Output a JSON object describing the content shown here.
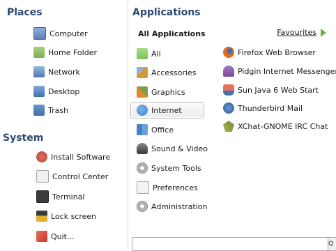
{
  "places": {
    "heading": "Places",
    "items": [
      {
        "label": "Computer",
        "icon": "computer-icon",
        "color": "#5a7fb0"
      },
      {
        "label": "Home Folder",
        "icon": "home-folder-icon",
        "color": "#7dae56"
      },
      {
        "label": "Network",
        "icon": "network-icon",
        "color": "#4d78b3"
      },
      {
        "label": "Desktop",
        "icon": "desktop-icon",
        "color": "#3f6fb0"
      },
      {
        "label": "Trash",
        "icon": "trash-icon",
        "color": "#3e6fa8"
      }
    ]
  },
  "system": {
    "heading": "System",
    "items": [
      {
        "label": "Install Software",
        "icon": "install-software-icon",
        "color": "#b0463a"
      },
      {
        "label": "Control Center",
        "icon": "control-center-icon",
        "color": "#c9c9c9"
      },
      {
        "label": "Terminal",
        "icon": "terminal-icon",
        "color": "#3c3c3c"
      },
      {
        "label": "Lock screen",
        "icon": "lock-screen-icon",
        "color": "#e0b12b"
      },
      {
        "label": "Quit...",
        "icon": "quit-icon",
        "color": "#c43a2a"
      }
    ]
  },
  "applications": {
    "heading": "Applications",
    "all_apps_label": "All Applications",
    "favourites_label": "Favourites",
    "categories": [
      {
        "label": "All",
        "icon": "all-icon",
        "color": "#7dc25a"
      },
      {
        "label": "Accessories",
        "icon": "accessories-icon",
        "color": "#d49a3a"
      },
      {
        "label": "Graphics",
        "icon": "graphics-icon",
        "color": "#e08a2a"
      },
      {
        "label": "Internet",
        "icon": "internet-icon",
        "color": "#3f7fc8"
      },
      {
        "label": "Office",
        "icon": "office-icon",
        "color": "#4a7fc0"
      },
      {
        "label": "Sound & Video",
        "icon": "sound-video-icon",
        "color": "#5a5a5a"
      },
      {
        "label": "System Tools",
        "icon": "system-tools-icon",
        "color": "#a0a0a0"
      },
      {
        "label": "Preferences",
        "icon": "preferences-icon",
        "color": "#bdbdbd"
      },
      {
        "label": "Administration",
        "icon": "administration-icon",
        "color": "#a0a0a0"
      }
    ],
    "selected_category": "Internet",
    "apps": [
      {
        "label": "Firefox Web Browser",
        "icon": "firefox-icon",
        "color": "#e36a1e"
      },
      {
        "label": "Pidgin Internet Messenger",
        "icon": "pidgin-icon",
        "color": "#7a4b9c"
      },
      {
        "label": "Sun Java 6 Web Start",
        "icon": "java-icon",
        "color": "#d0402a"
      },
      {
        "label": "Thunderbird Mail",
        "icon": "thunderbird-icon",
        "color": "#2d5c9a"
      },
      {
        "label": "XChat-GNOME IRC Chat",
        "icon": "xchat-icon",
        "color": "#7a8a3a"
      }
    ]
  },
  "search": {
    "button_glyph": "Q"
  }
}
